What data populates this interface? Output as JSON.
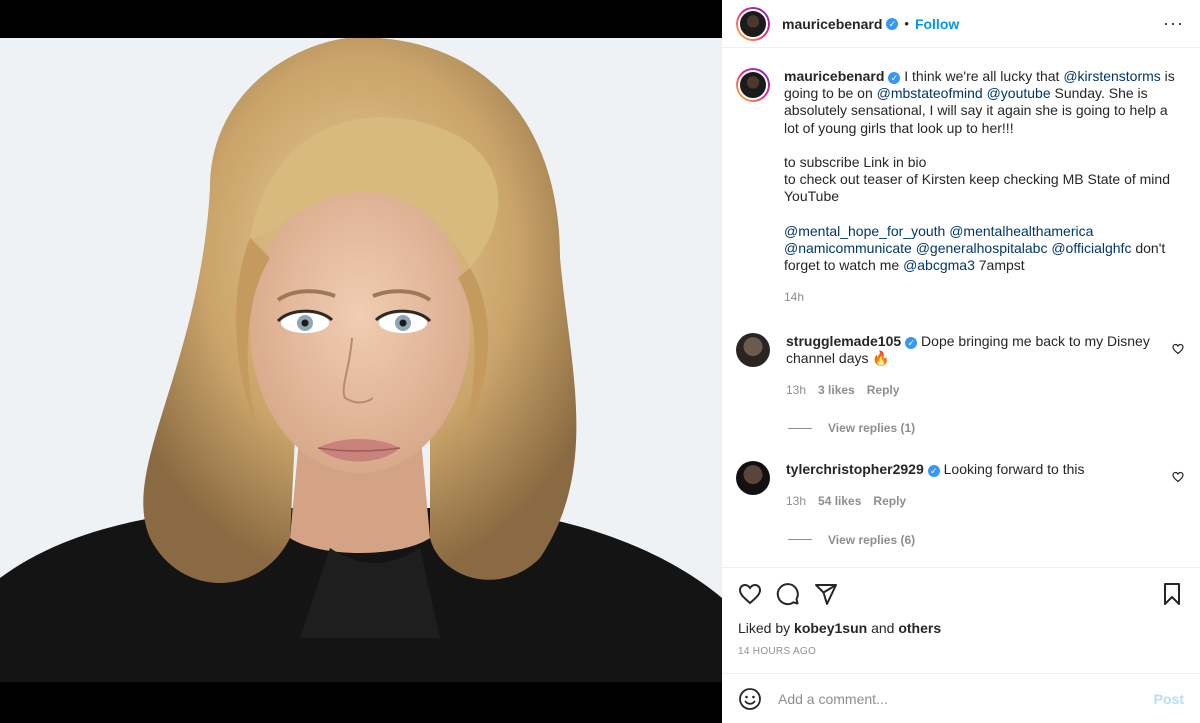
{
  "post": {
    "author": "mauricebenard",
    "follow_label": "Follow",
    "more_label": "···",
    "dot": "•"
  },
  "caption": {
    "username": "mauricebenard",
    "part1": " I think we're all lucky that ",
    "mention1": "@kirstenstorms",
    "part2": " is going to be on ",
    "mention2": "@mbstateofmind",
    "part3": " ",
    "mention3": "@youtube",
    "part4": " Sunday. She is absolutely sensational, I will say it again she is going to help a lot of young girls that look up to her!!!",
    "line2": "to subscribe Link in bio",
    "line3": "to check out teaser of Kirsten keep checking MB State of mind YouTube",
    "mention4": "@mental_hope_for_youth",
    "mention5": "@mentalhealthamerica",
    "mention6": "@namicommunicate",
    "mention7": "@generalhospitalabc",
    "mention8": "@officialghfc",
    "part5": " don't forget to watch me ",
    "mention9": "@abcgma3",
    "part6": " 7ampst",
    "time": "14h"
  },
  "comments": [
    {
      "username": "strugglemade105",
      "text": " Dope bringing me back to my Disney channel days 🔥",
      "time": "13h",
      "likes": "3 likes",
      "reply": "Reply",
      "view_replies": "View replies (1)"
    },
    {
      "username": "tylerchristopher2929",
      "text": " Looking forward to this",
      "time": "13h",
      "likes": "54 likes",
      "reply": "Reply",
      "view_replies": "View replies (6)"
    }
  ],
  "likes": {
    "prefix": "Liked by ",
    "user": "kobey1sun",
    "middle": " and ",
    "others": "others"
  },
  "timestamp": "14 HOURS AGO",
  "add_comment": {
    "placeholder": "Add a comment...",
    "post_label": "Post"
  },
  "colors": {
    "link": "#00376b",
    "follow": "#0095f6",
    "verified": "#3897f0",
    "muted": "#8e8e8e"
  }
}
